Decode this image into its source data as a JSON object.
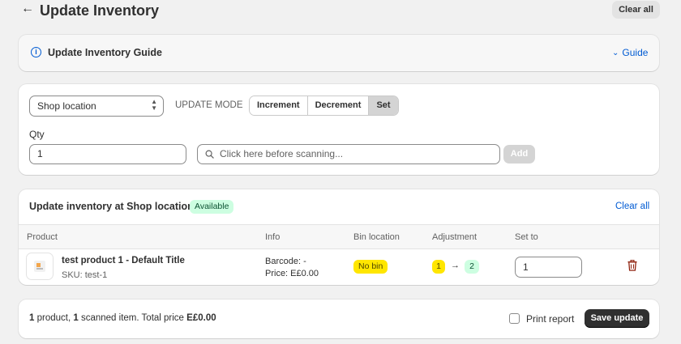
{
  "header": {
    "back_icon": "←",
    "title": "Update Inventory",
    "clear_all_label": "Clear all"
  },
  "guide": {
    "info_icon": "i",
    "title": "Update Inventory Guide",
    "link_label": "Guide",
    "chevron_icon": "⌄"
  },
  "controls": {
    "location_select": "Shop location",
    "update_mode_label": "UPDATE MODE",
    "modes": [
      "Increment",
      "Decrement",
      "Set"
    ],
    "active_mode": "Set",
    "qty_label": "Qty",
    "qty_value": "1",
    "search_placeholder": "Click here before scanning...",
    "add_label": "Add"
  },
  "inventory": {
    "title": "Update inventory at Shop location",
    "status_badge": "Available",
    "clear_all_label": "Clear all",
    "columns": [
      "Product",
      "Info",
      "Bin location",
      "Adjustment",
      "Set to"
    ],
    "rows": [
      {
        "product_name": "test product 1 - Default Title",
        "sku": "SKU: test-1",
        "barcode": "Barcode: -",
        "price": "Price: E£0.00",
        "bin": "No bin",
        "adjust_from": "1",
        "adjust_arrow": "→",
        "adjust_to": "2",
        "set_to": "1"
      }
    ]
  },
  "footer": {
    "product_count": "1",
    "product_word": " product, ",
    "scanned_count": "1",
    "scanned_text": " scanned item. Total price ",
    "total_price": "E£0.00",
    "print_report_label": "Print report",
    "save_label": "Save update"
  },
  "colors": {
    "accent_link": "#005bd3",
    "success_bg": "#cdfee1",
    "warning_bg": "#ffe600",
    "primary_button": "#303030",
    "delete_icon": "#8e1f0b"
  }
}
